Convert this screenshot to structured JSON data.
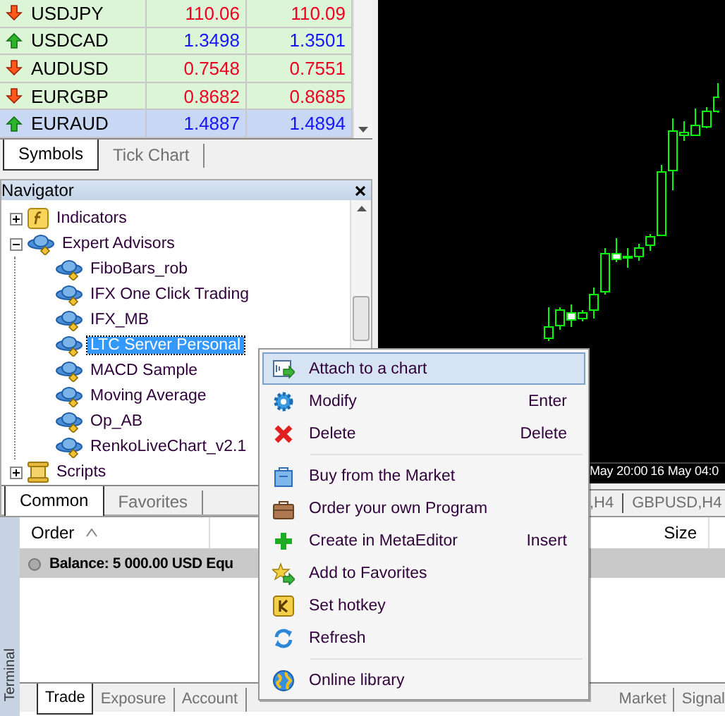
{
  "market_watch": {
    "rows": [
      {
        "symbol": "USDJPY",
        "rising": false,
        "bid": "110.06",
        "ask": "110.09",
        "selected": false
      },
      {
        "symbol": "USDCAD",
        "rising": true,
        "bid": "1.3498",
        "ask": "1.3501",
        "selected": false
      },
      {
        "symbol": "AUDUSD",
        "rising": false,
        "bid": "0.7548",
        "ask": "0.7551",
        "selected": false
      },
      {
        "symbol": "EURGBP",
        "rising": false,
        "bid": "0.8682",
        "ask": "0.8685",
        "selected": false
      },
      {
        "symbol": "EURAUD",
        "rising": true,
        "bid": "1.4887",
        "ask": "1.4894",
        "selected": true
      }
    ],
    "tabs": [
      {
        "label": "Symbols",
        "selected": true
      },
      {
        "label": "Tick Chart",
        "selected": false
      }
    ]
  },
  "navigator": {
    "title": "Navigator",
    "tree": [
      {
        "label": "Indicators",
        "expanded": false,
        "selected": false
      },
      {
        "label": "Expert Advisors",
        "expanded": true,
        "selected": false,
        "children": [
          {
            "label": "FiboBars_rob",
            "selected": false
          },
          {
            "label": "IFX One Click Trading",
            "selected": false
          },
          {
            "label": "IFX_MB",
            "selected": false
          },
          {
            "label": "LTC Server Personal",
            "selected": true
          },
          {
            "label": "MACD Sample",
            "selected": false
          },
          {
            "label": "Moving Average",
            "selected": false
          },
          {
            "label": "Op_AB",
            "selected": false
          },
          {
            "label": "RenkoLiveChart_v2.1",
            "selected": false
          }
        ]
      },
      {
        "label": "Scripts",
        "expanded": false,
        "selected": false
      }
    ],
    "tabs": [
      {
        "label": "Common",
        "selected": true
      },
      {
        "label": "Favorites",
        "selected": false
      }
    ]
  },
  "chart": {
    "time_labels": [
      "May 20:00",
      "16 May 04:0"
    ],
    "tabs": [
      ",H4",
      "GBPUSD,H4"
    ]
  },
  "terminal": {
    "title": "Terminal",
    "columns": [
      "Order",
      "Size"
    ],
    "balance": "Balance: 5 000.00 USD  Equ",
    "tabs": [
      {
        "label": "Trade",
        "selected": true
      },
      {
        "label": "Exposure",
        "selected": false
      },
      {
        "label": "Account",
        "selected": false
      },
      {
        "label": "Market",
        "selected": false
      },
      {
        "label": "Signal",
        "selected": false
      }
    ]
  },
  "context_menu": {
    "groups": [
      [
        {
          "label": "Attach to a chart",
          "selected": true
        },
        {
          "label": "Modify",
          "shortcut": "Enter",
          "selected": false
        },
        {
          "label": "Delete",
          "shortcut": "Delete",
          "selected": false
        }
      ],
      [
        {
          "label": "Buy from the Market",
          "selected": false
        },
        {
          "label": "Order your own Program",
          "selected": false
        },
        {
          "label": "Create in MetaEditor",
          "shortcut": "Insert",
          "selected": false
        },
        {
          "label": "Add to Favorites",
          "selected": false
        },
        {
          "label": "Set hotkey",
          "selected": false
        },
        {
          "label": "Refresh",
          "selected": false
        }
      ],
      [
        {
          "label": "Online library",
          "selected": false
        }
      ]
    ]
  }
}
